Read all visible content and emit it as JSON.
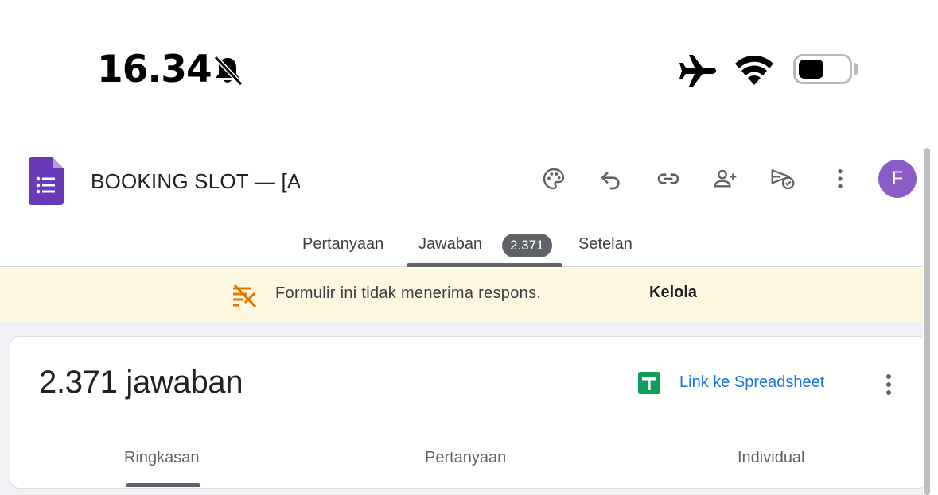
{
  "status_bar": {
    "time": "16.34",
    "icons": [
      "bell-muted-icon",
      "airplane-mode-icon",
      "wifi-icon",
      "battery-icon"
    ],
    "battery_level": 0.5
  },
  "header": {
    "form_title": "BOOKING SLOT — [AREA]",
    "toolbar": [
      "palette-icon",
      "undo-icon",
      "link-icon",
      "add-collaborator-icon",
      "send-icon",
      "more-vert-icon"
    ],
    "avatar_initial": "F",
    "avatar_color": "#8a5cc5"
  },
  "tabs": [
    {
      "label": "Pertanyaan"
    },
    {
      "label": "Jawaban",
      "badge": "2.371"
    },
    {
      "label": "Setelan"
    }
  ],
  "notice": {
    "text": "Formulir ini tidak menerima respons.",
    "action": "Kelola"
  },
  "responses": {
    "count_label": "2.371 jawaban",
    "sheet_link": "Link ke Spreadsheet",
    "subtabs": [
      {
        "label": "Ringkasan"
      },
      {
        "label": "Pertanyaan"
      },
      {
        "label": "Individual"
      }
    ]
  },
  "colors": {
    "forms_purple": "#673ab7",
    "notice_bg": "#fef7e0",
    "link_blue": "#1a73e8",
    "sheets_green": "#0f9d58"
  }
}
